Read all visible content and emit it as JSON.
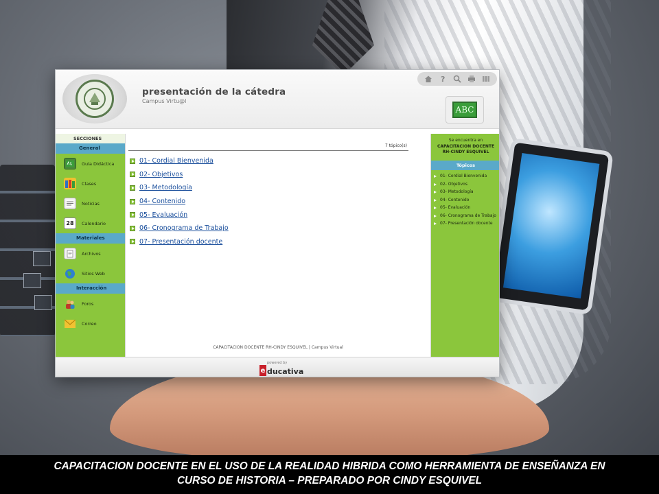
{
  "header": {
    "title": "presentación de la cátedra",
    "subtitle": "Campus Virtu@l",
    "badge": "ABC",
    "toolbar_icons": [
      "home-icon",
      "help-icon",
      "search-icon",
      "print-icon",
      "map-icon"
    ]
  },
  "left_sidebar": {
    "title": "SECCIONES",
    "groups": [
      {
        "label": "General",
        "items": [
          {
            "label": "Guía Didáctica",
            "icon": "abc-icon"
          },
          {
            "label": "Clases",
            "icon": "books-icon"
          },
          {
            "label": "Noticias",
            "icon": "news-icon"
          },
          {
            "label": "Calendario",
            "icon": "calendar-icon",
            "icon_text": "28"
          }
        ]
      },
      {
        "label": "Materiales",
        "items": [
          {
            "label": "Archivos",
            "icon": "folder-icon"
          },
          {
            "label": "Sitios Web",
            "icon": "globe-icon"
          }
        ]
      },
      {
        "label": "Interacción",
        "items": [
          {
            "label": "Foros",
            "icon": "forum-icon"
          },
          {
            "label": "Correo",
            "icon": "mail-icon"
          }
        ]
      }
    ]
  },
  "main": {
    "topic_count": "7 tópico(s)",
    "topics": [
      "01- Cordial Bienvenida",
      "02- Objetivos",
      "03- Metodología",
      "04- Contenido",
      "05- Evaluación",
      "06- Cronograma de Trabajo",
      "07- Presentación docente"
    ],
    "footer": "CAPACITACION DOCENTE RH-CINDY ESQUIVEL | Campus Virtual"
  },
  "right_sidebar": {
    "location_intro": "Se encuentra en",
    "location_name": "CAPACITACION DOCENTE RH-CINDY ESQUIVEL",
    "topics_header": "Tópicos",
    "topics": [
      "01- Cordial Bienvenida",
      "02- Objetivos",
      "03- Metodología",
      "04- Contenido",
      "05- Evaluación",
      "06- Cronograma de Trabajo",
      "07- Presentación docente"
    ]
  },
  "footer": {
    "powered_by": "powered by",
    "brand_initial": "e",
    "brand_rest": "ducativa"
  },
  "caption": {
    "line1": "CAPACITACION DOCENTE EN EL USO DE LA REALIDAD HIBRIDA COMO HERRAMIENTA DE ENSEÑANZA EN",
    "line2": "CURSO DE HISTORIA – PREPARADO POR CINDY ESQUIVEL"
  },
  "colors": {
    "sidebar_green": "#8bc63c",
    "section_blue": "#5aa9c9",
    "link_blue": "#1b4f9c",
    "brand_red": "#c8202a"
  }
}
